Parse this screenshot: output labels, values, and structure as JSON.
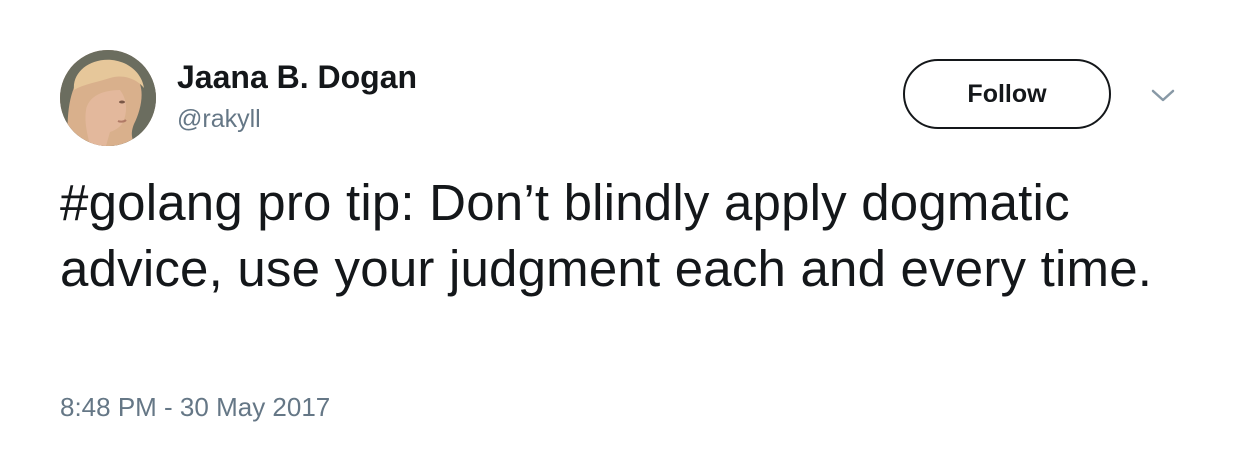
{
  "tweet": {
    "author": {
      "display_name": "Jaana B. Dogan",
      "handle": "@rakyll",
      "avatar_icon": "profile-photo"
    },
    "follow_label": "Follow",
    "menu_icon": "chevron-down-icon",
    "text": "#golang pro tip: Don’t blindly apply dogmatic advice, use your judgment each and every time.",
    "timestamp": "8:48 PM - 30 May 2017"
  },
  "colors": {
    "text_primary": "#14171a",
    "text_secondary": "#657786",
    "background": "#ffffff"
  }
}
